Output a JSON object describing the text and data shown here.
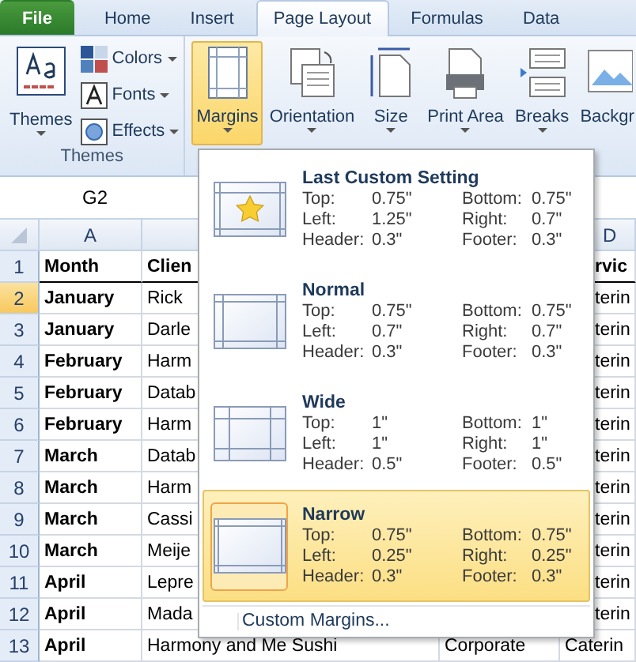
{
  "tabs": [
    {
      "label": "File",
      "kind": "file",
      "selected": false
    },
    {
      "label": "Home",
      "kind": "tab",
      "selected": false
    },
    {
      "label": "Insert",
      "kind": "tab",
      "selected": false
    },
    {
      "label": "Page Layout",
      "kind": "tab",
      "selected": true
    },
    {
      "label": "Formulas",
      "kind": "tab",
      "selected": false
    },
    {
      "label": "Data",
      "kind": "tab",
      "selected": false
    }
  ],
  "themes_group": {
    "label": "Themes",
    "main_button": "Themes",
    "buttons": [
      {
        "label": "Colors",
        "kind": "colors"
      },
      {
        "label": "Fonts",
        "kind": "fonts"
      },
      {
        "label": "Effects",
        "kind": "effects"
      }
    ]
  },
  "page_setup_buttons": [
    {
      "label": "Margins",
      "kind": "margins",
      "selected": true
    },
    {
      "label": "Orientation",
      "kind": "orientation",
      "selected": false
    },
    {
      "label": "Size",
      "kind": "size",
      "selected": false
    },
    {
      "label": "Print Area",
      "kind": "print",
      "selected": false
    },
    {
      "label": "Breaks",
      "kind": "breaks",
      "selected": false
    },
    {
      "label": "Backgr",
      "kind": "background",
      "selected": false
    }
  ],
  "name_box": "G2",
  "column_headers": [
    "A",
    "D"
  ],
  "rows": [
    {
      "number": "1",
      "selected": false,
      "cells": [
        "Month",
        "Clien",
        null,
        "rvic"
      ]
    },
    {
      "number": "2",
      "selected": true,
      "cells": [
        "January",
        "Rick",
        null,
        "terin"
      ]
    },
    {
      "number": "3",
      "selected": false,
      "cells": [
        "January",
        "Darle",
        null,
        "terin"
      ]
    },
    {
      "number": "4",
      "selected": false,
      "cells": [
        "February",
        "Harm",
        null,
        "terin"
      ]
    },
    {
      "number": "5",
      "selected": false,
      "cells": [
        "February",
        "Datab",
        null,
        "terin"
      ]
    },
    {
      "number": "6",
      "selected": false,
      "cells": [
        "February",
        "Harm",
        null,
        "terin"
      ]
    },
    {
      "number": "7",
      "selected": false,
      "cells": [
        "March",
        "Datab",
        null,
        "terin"
      ]
    },
    {
      "number": "8",
      "selected": false,
      "cells": [
        "March",
        "Harm",
        null,
        "terin"
      ]
    },
    {
      "number": "9",
      "selected": false,
      "cells": [
        "March",
        "Cassi",
        null,
        "terin"
      ]
    },
    {
      "number": "10",
      "selected": false,
      "cells": [
        "March",
        "Meije",
        null,
        "terin"
      ]
    },
    {
      "number": "11",
      "selected": false,
      "cells": [
        "April",
        "Lepre",
        null,
        "terin"
      ]
    },
    {
      "number": "12",
      "selected": false,
      "cells": [
        "April",
        "Mada",
        null,
        "terin"
      ]
    },
    {
      "number": "13",
      "selected": false,
      "cells": [
        "April",
        "Harmony and Me Sushi",
        "Corporate",
        "Caterin"
      ]
    }
  ],
  "margins_menu": {
    "items": [
      {
        "title": "Last Custom Setting",
        "kind": "custom",
        "selected": false,
        "values": [
          [
            "Top:",
            "0.75\"",
            "Bottom:",
            "0.75\""
          ],
          [
            "Left:",
            "1.25\"",
            "Right:",
            "0.7\""
          ],
          [
            "Header:",
            "0.3\"",
            "Footer:",
            "0.3\""
          ]
        ]
      },
      {
        "title": "Normal",
        "kind": "normal",
        "selected": false,
        "values": [
          [
            "Top:",
            "0.75\"",
            "Bottom:",
            "0.75\""
          ],
          [
            "Left:",
            "0.7\"",
            "Right:",
            "0.7\""
          ],
          [
            "Header:",
            "0.3\"",
            "Footer:",
            "0.3\""
          ]
        ]
      },
      {
        "title": "Wide",
        "kind": "wide",
        "selected": false,
        "values": [
          [
            "Top:",
            "1\"",
            "Bottom:",
            "1\""
          ],
          [
            "Left:",
            "1\"",
            "Right:",
            "1\""
          ],
          [
            "Header:",
            "0.5\"",
            "Footer:",
            "0.5\""
          ]
        ]
      },
      {
        "title": "Narrow",
        "kind": "narrow",
        "selected": true,
        "values": [
          [
            "Top:",
            "0.75\"",
            "Bottom:",
            "0.75\""
          ],
          [
            "Left:",
            "0.25\"",
            "Right:",
            "0.25\""
          ],
          [
            "Header:",
            "0.3\"",
            "Footer:",
            "0.3\""
          ]
        ]
      }
    ],
    "footer": "Custom Margins..."
  }
}
